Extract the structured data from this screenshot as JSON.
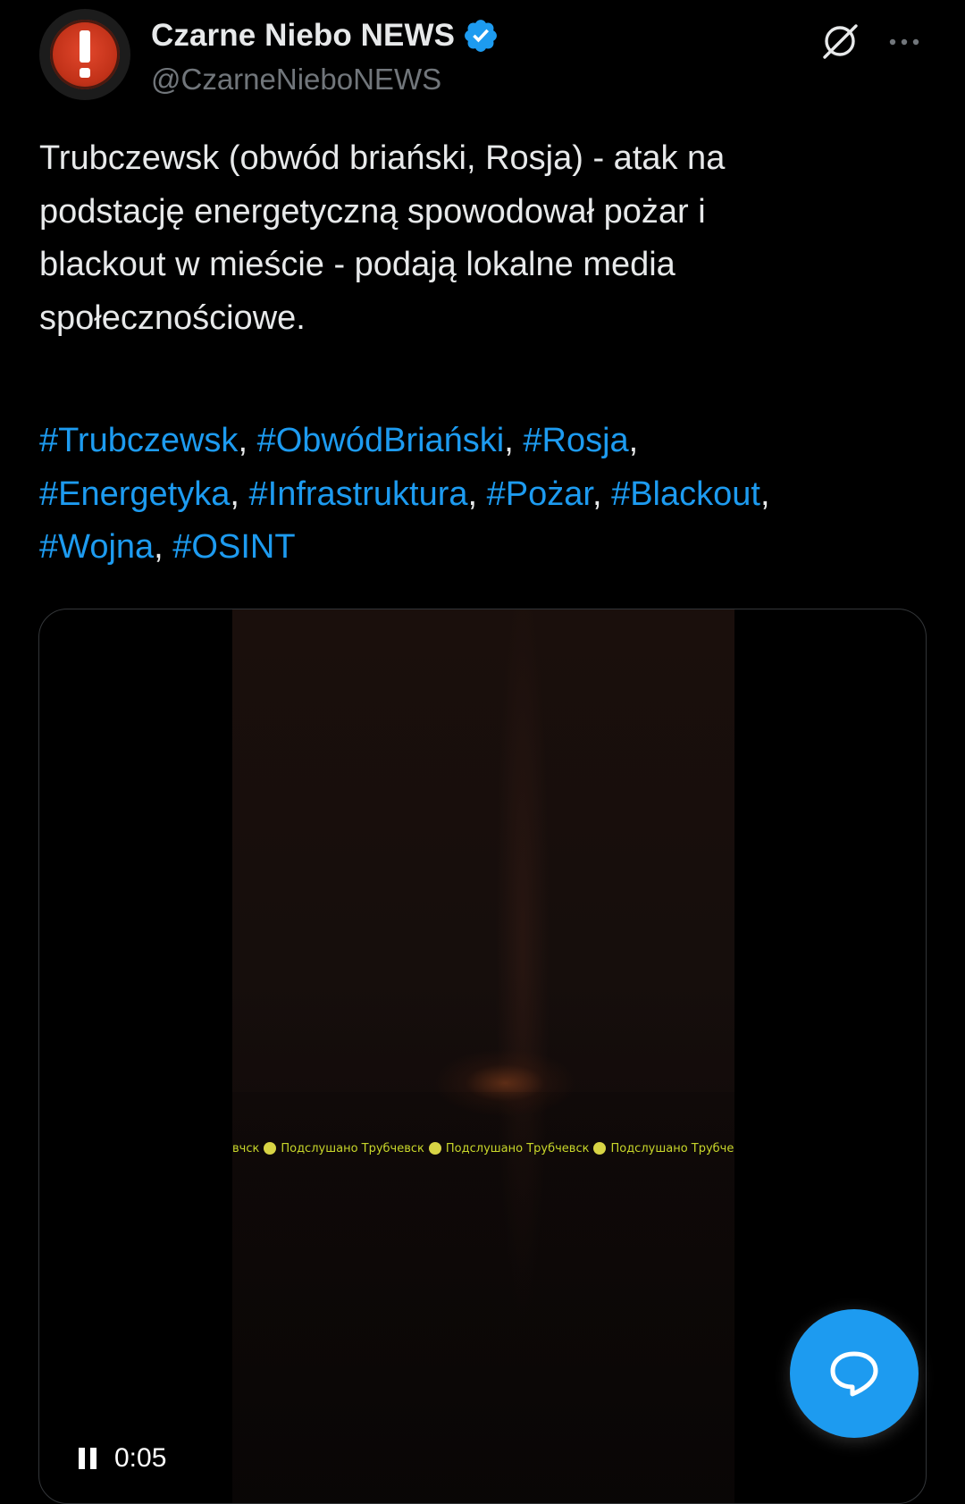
{
  "author": {
    "display_name": "Czarne Niebo NEWS",
    "handle": "@CzarneNieboNEWS",
    "verified": true,
    "avatar_icon": "exclamation-icon"
  },
  "header_icons": {
    "grok": "grok-icon",
    "more": "more-icon"
  },
  "tweet": {
    "text_lines": [
      "Trubczewsk (obwód briański, Rosja) - atak na",
      "podstację energetyczną spowodował pożar i",
      "blackout w mieście - podają lokalne media",
      "społecznościowe."
    ],
    "hashtags": [
      "#Trubczewsk",
      "#ObwódBriański",
      "#Rosja",
      "#Energetyka",
      "#Infrastruktura",
      "#Pożar",
      "#Blackout",
      "#Wojna",
      "#OSINT"
    ]
  },
  "video": {
    "watermark_text": "Подслушано Трубчевск",
    "watermark_lead": "вчск",
    "time": "0:05",
    "state": "playing",
    "control_icon": "pause-icon"
  },
  "colors": {
    "background": "#000000",
    "text": "#e7e9ea",
    "secondary": "#71767b",
    "accent": "#1d9bf0",
    "border": "#333639"
  },
  "compose_button": {
    "icon": "chat-bubble-icon"
  }
}
